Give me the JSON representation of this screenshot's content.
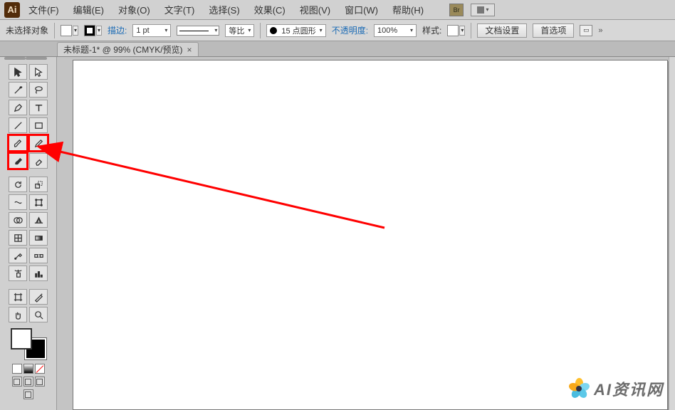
{
  "menubar": {
    "logo_text": "Ai",
    "items": [
      "文件(F)",
      "编辑(E)",
      "对象(O)",
      "文字(T)",
      "选择(S)",
      "效果(C)",
      "视图(V)",
      "窗口(W)",
      "帮助(H)"
    ],
    "br_badge": "Br"
  },
  "ctrlbar": {
    "no_selection": "未选择对象",
    "stroke_label": "描边:",
    "stroke_value": "1 pt",
    "scale_label": "等比",
    "brush_value": "15 点圆形",
    "opacity_label": "不透明度:",
    "opacity_value": "100%",
    "style_label": "样式:",
    "btn_docsetup": "文档设置",
    "btn_prefs": "首选项"
  },
  "tab": {
    "title": "未标题-1* @ 99% (CMYK/预览)"
  },
  "watermark": {
    "text": "AI资讯网"
  },
  "tools": {
    "names": [
      [
        "selection",
        "direct-selection"
      ],
      [
        "magic-wand",
        "lasso"
      ],
      [
        "pen",
        "type"
      ],
      [
        "line-segment",
        "rectangle"
      ],
      [
        "paintbrush",
        "pencil"
      ],
      [
        "blob-brush",
        "eraser"
      ],
      [
        "rotate",
        "scale"
      ],
      [
        "width",
        "free-transform"
      ],
      [
        "shape-builder",
        "perspective-grid"
      ],
      [
        "mesh",
        "gradient"
      ],
      [
        "eyedropper",
        "blend"
      ],
      [
        "symbol-sprayer",
        "column-graph"
      ],
      [
        "artboard",
        "slice"
      ],
      [
        "hand",
        "zoom"
      ]
    ]
  }
}
